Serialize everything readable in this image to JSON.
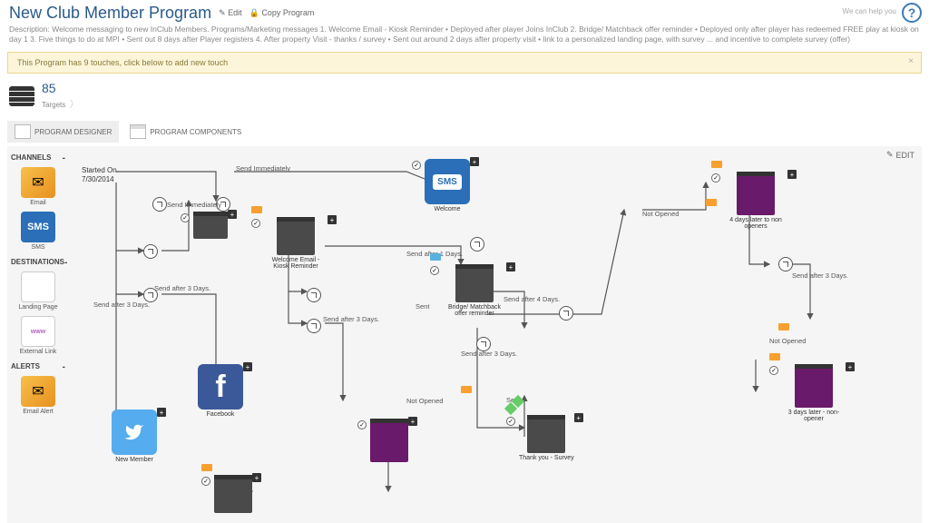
{
  "header": {
    "title": "New Club Member Program",
    "edit_action": "Edit",
    "copy_action": "Copy Program",
    "description": "Description: Welcome messaging to new InClub Members. Programs/Marketing messages 1. Welcome Email - Kiosk Reminder • Deployed after player Joins InClub 2. Bridge/ Matchback offer reminder • Deployed only after player has redeemed FREE play at kiosk on day 1 3. Five things to do at MPI • Sent out 8 days after Player registers 4. After property Visit - thanks / survey • Sent out around 2 days after property visit • link to a personalized landing page, with survey ... and incentive to complete survey (offer)",
    "help_text": "We can help you"
  },
  "notice": {
    "text": "This Program has 9 touches, click below to add new touch"
  },
  "targets": {
    "count": "85",
    "label": "Targets"
  },
  "tabs": {
    "designer": "PROGRAM DESIGNER",
    "components": "PROGRAM COMPONENTS"
  },
  "canvas": {
    "edit_btn": "EDIT"
  },
  "sidebar": {
    "channels_header": "CHANNELS",
    "destinations_header": "DESTINATIONS",
    "alerts_header": "ALERTS",
    "email": "Email",
    "sms": "SMS",
    "landing_page": "Landing Page",
    "external_link": "External Link",
    "email_alert": "Email Alert",
    "www": "www"
  },
  "flow": {
    "start": {
      "label": "Started On",
      "date": "7/30/2014"
    },
    "send_immediately": "Send Immediately",
    "send_after_1": "Send after 1 Days.",
    "send_after_3": "Send after 3 Days.",
    "send_after_4": "Send after 4 Days.",
    "sent": "Sent",
    "not_opened": "Not Opened",
    "nodes": {
      "facebook": "Facebook",
      "new_member": "New Member",
      "welcome": "Welcome",
      "welcome_kiosk": "Welcome Email - Kiosk Reminder",
      "bridge": "Bridge/ Matchback offer reminder",
      "thankyou": "Thank you - Survey",
      "4days": "4 days later to non openers",
      "3days": "3 days later - non-opener"
    },
    "sms_label": "SMS"
  }
}
